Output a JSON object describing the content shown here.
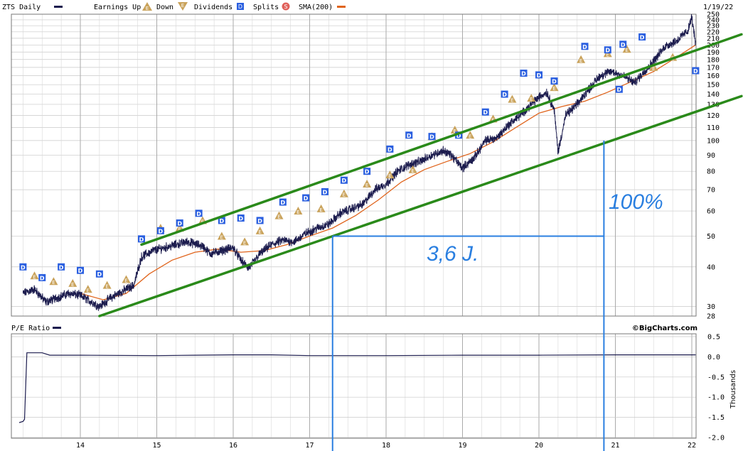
{
  "header": {
    "symbol": "ZTS Daily",
    "earnings_label": "Earnings Up",
    "down_label": "Down",
    "dividends_label": "Dividends",
    "splits_label": "Splits",
    "sma_label": "SMA(200)",
    "date": "1/19/22",
    "earnings_glyph": "E",
    "dividend_glyph": "D",
    "split_glyph": "S"
  },
  "lower_header": {
    "label": "P/E Ratio",
    "credit": "©BigCharts.com"
  },
  "annotations": {
    "duration": "3,6 J.",
    "gain": "100%"
  },
  "colors": {
    "price": "#1c1c4e",
    "sma": "#e0641c",
    "trend": "#2a8a1a",
    "annotation": "#2a7fe0",
    "dividend": "#2a5fe0",
    "earnings": "#c9a25a",
    "grid": "#c8c8c8"
  },
  "chart_data": [
    {
      "type": "line",
      "title": "ZTS Daily",
      "x": [
        "14",
        "15",
        "16",
        "17",
        "18",
        "19",
        "20",
        "21",
        "22"
      ],
      "y_scale": "log",
      "ylim": [
        28,
        250
      ],
      "y_ticks": [
        250,
        240,
        230,
        220,
        210,
        200,
        190,
        180,
        170,
        160,
        150,
        140,
        130,
        120,
        110,
        100,
        90,
        80,
        70,
        60,
        50,
        40,
        30,
        28
      ],
      "legend": "top",
      "series": [
        {
          "name": "ZTS Daily",
          "points": [
            [
              13.25,
              33
            ],
            [
              13.4,
              34
            ],
            [
              13.55,
              31
            ],
            [
              13.7,
              32
            ],
            [
              13.85,
              33
            ],
            [
              14.0,
              32.5
            ],
            [
              14.15,
              31
            ],
            [
              14.25,
              30
            ],
            [
              14.4,
              32
            ],
            [
              14.55,
              33.5
            ],
            [
              14.7,
              35
            ],
            [
              14.8,
              43
            ],
            [
              14.95,
              45
            ],
            [
              15.1,
              46
            ],
            [
              15.25,
              47
            ],
            [
              15.4,
              48
            ],
            [
              15.6,
              46.5
            ],
            [
              15.7,
              44
            ],
            [
              15.85,
              45
            ],
            [
              16.0,
              46
            ],
            [
              16.1,
              42
            ],
            [
              16.2,
              39.5
            ],
            [
              16.35,
              44
            ],
            [
              16.5,
              47
            ],
            [
              16.65,
              48.5
            ],
            [
              16.8,
              48
            ],
            [
              16.95,
              51
            ],
            [
              17.1,
              53
            ],
            [
              17.25,
              54.5
            ],
            [
              17.4,
              59
            ],
            [
              17.55,
              61
            ],
            [
              17.7,
              63
            ],
            [
              17.85,
              70
            ],
            [
              18.0,
              73
            ],
            [
              18.15,
              80
            ],
            [
              18.3,
              84
            ],
            [
              18.45,
              86
            ],
            [
              18.6,
              90
            ],
            [
              18.75,
              93
            ],
            [
              18.85,
              90
            ],
            [
              19.0,
              82
            ],
            [
              19.15,
              88
            ],
            [
              19.3,
              100
            ],
            [
              19.45,
              102
            ],
            [
              19.6,
              112
            ],
            [
              19.75,
              120
            ],
            [
              19.9,
              130
            ],
            [
              20.0,
              137
            ],
            [
              20.1,
              142
            ],
            [
              20.2,
              125
            ],
            [
              20.25,
              92
            ],
            [
              20.35,
              120
            ],
            [
              20.5,
              130
            ],
            [
              20.65,
              145
            ],
            [
              20.8,
              160
            ],
            [
              20.95,
              165
            ],
            [
              21.1,
              160
            ],
            [
              21.25,
              152
            ],
            [
              21.35,
              162
            ],
            [
              21.5,
              178
            ],
            [
              21.65,
              198
            ],
            [
              21.8,
              206
            ],
            [
              21.95,
              222
            ],
            [
              22.0,
              245
            ],
            [
              22.05,
              200
            ]
          ]
        },
        {
          "name": "SMA(200)",
          "points": [
            [
              14.0,
              33
            ],
            [
              14.3,
              31.5
            ],
            [
              14.6,
              33
            ],
            [
              14.9,
              38
            ],
            [
              15.2,
              42
            ],
            [
              15.5,
              44.5
            ],
            [
              15.8,
              45.5
            ],
            [
              16.1,
              44.5
            ],
            [
              16.4,
              45
            ],
            [
              16.7,
              47
            ],
            [
              17.0,
              50
            ],
            [
              17.3,
              53
            ],
            [
              17.6,
              58
            ],
            [
              17.9,
              65
            ],
            [
              18.2,
              74
            ],
            [
              18.5,
              81
            ],
            [
              18.8,
              86
            ],
            [
              19.1,
              91
            ],
            [
              19.4,
              99
            ],
            [
              19.7,
              110
            ],
            [
              20.0,
              122
            ],
            [
              20.3,
              128
            ],
            [
              20.6,
              133
            ],
            [
              20.9,
              142
            ],
            [
              21.2,
              153
            ],
            [
              21.5,
              165
            ],
            [
              21.8,
              183
            ],
            [
              22.05,
              200
            ]
          ]
        }
      ],
      "earnings_markers": [
        [
          13.4,
          37.5
        ],
        [
          13.65,
          36
        ],
        [
          13.9,
          35.5
        ],
        [
          14.1,
          34
        ],
        [
          14.35,
          35
        ],
        [
          14.6,
          36.5
        ],
        [
          15.05,
          53
        ],
        [
          15.3,
          53
        ],
        [
          15.6,
          56
        ],
        [
          15.85,
          50
        ],
        [
          16.15,
          48
        ],
        [
          16.35,
          52
        ],
        [
          16.6,
          58
        ],
        [
          16.85,
          60
        ],
        [
          17.15,
          61
        ],
        [
          17.45,
          68
        ],
        [
          17.75,
          73
        ],
        [
          18.05,
          78
        ],
        [
          18.35,
          81
        ],
        [
          18.6,
          103
        ],
        [
          18.9,
          108
        ],
        [
          19.1,
          104
        ],
        [
          19.4,
          117
        ],
        [
          19.65,
          135
        ],
        [
          19.9,
          136
        ],
        [
          20.2,
          147
        ],
        [
          20.55,
          180
        ],
        [
          20.9,
          188
        ],
        [
          21.15,
          194
        ],
        [
          21.5,
          170
        ],
        [
          21.75,
          183
        ]
      ],
      "dividend_markers": [
        [
          13.25,
          40
        ],
        [
          13.5,
          37
        ],
        [
          13.75,
          40
        ],
        [
          14.0,
          39
        ],
        [
          14.25,
          38
        ],
        [
          14.8,
          49
        ],
        [
          15.05,
          52
        ],
        [
          15.3,
          55
        ],
        [
          15.55,
          59
        ],
        [
          15.85,
          56
        ],
        [
          16.1,
          57
        ],
        [
          16.35,
          56
        ],
        [
          16.65,
          64
        ],
        [
          16.95,
          66
        ],
        [
          17.2,
          69
        ],
        [
          17.45,
          75
        ],
        [
          17.75,
          80
        ],
        [
          18.05,
          94
        ],
        [
          18.3,
          104
        ],
        [
          18.6,
          103
        ],
        [
          18.95,
          104
        ],
        [
          19.3,
          123
        ],
        [
          19.55,
          140
        ],
        [
          19.8,
          163
        ],
        [
          20.0,
          161
        ],
        [
          20.2,
          154
        ],
        [
          20.6,
          198
        ],
        [
          20.9,
          193
        ],
        [
          21.1,
          201
        ],
        [
          21.35,
          212
        ],
        [
          21.05,
          145
        ],
        [
          22.05,
          166
        ]
      ],
      "trendlines": [
        {
          "points": [
            [
              14.25,
              28
            ],
            [
              22.65,
              138
            ]
          ]
        },
        {
          "points": [
            [
              14.8,
              47
            ],
            [
              22.65,
              216
            ]
          ]
        }
      ],
      "channel_box": {
        "x_start": 17.3,
        "x_end": 20.85,
        "y_bottom": 50,
        "y_top": 100
      }
    },
    {
      "type": "line",
      "title": "P/E Ratio",
      "x": [
        "14",
        "15",
        "16",
        "17",
        "18",
        "19",
        "20",
        "21",
        "22"
      ],
      "ylim": [
        -2.0,
        0.5
      ],
      "y_ticks": [
        "0.5",
        "0.0",
        "-0.5",
        "-1.0",
        "-1.5",
        "-2.0"
      ],
      "ylabel": "Thousands",
      "series": [
        {
          "name": "P/E Ratio",
          "points": [
            [
              13.2,
              -1.63
            ],
            [
              13.25,
              -1.6
            ],
            [
              13.27,
              -1.55
            ],
            [
              13.3,
              0.1
            ],
            [
              13.5,
              0.1
            ],
            [
              13.6,
              0.04
            ],
            [
              14.0,
              0.04
            ],
            [
              15.0,
              0.03
            ],
            [
              15.5,
              0.04
            ],
            [
              16.0,
              0.05
            ],
            [
              16.5,
              0.05
            ],
            [
              17.0,
              0.03
            ],
            [
              18.0,
              0.03
            ],
            [
              19.0,
              0.04
            ],
            [
              20.0,
              0.04
            ],
            [
              21.0,
              0.05
            ],
            [
              22.0,
              0.05
            ],
            [
              22.05,
              0.05
            ]
          ]
        }
      ]
    }
  ]
}
